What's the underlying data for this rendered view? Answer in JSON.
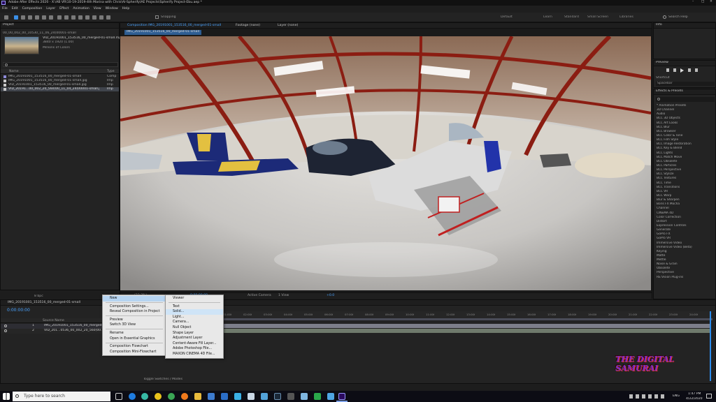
{
  "app": {
    "title": "Adobe After Effects 2020 - X:\\AB VR\\10-19-2019-4th Marina with Chris\\AI-Spherify\\AE Projects\\Spherify Project-Ebu.aep *"
  },
  "menubar": [
    "File",
    "Edit",
    "Composition",
    "Layer",
    "Effect",
    "Animation",
    "View",
    "Window",
    "Help"
  ],
  "toolbar": {
    "snapping_label": "Snapping",
    "workspaces": [
      "Default",
      "Learn",
      "Standard",
      "Small Screen",
      "Libraries"
    ],
    "search_placeholder": "Search Help"
  },
  "project_panel": {
    "tab": "Project",
    "top_label": "00_00_002_00_10530_11_06_24(00001-small",
    "preview_name": "VID_20191001_153516_00_merged-01-small.mp4 ▾",
    "preview_dims": "3840 x 1920 (1.00)",
    "preview_dur": "Millions of Colors",
    "search_icon": "search-icon",
    "col_name": "Name",
    "col_type": "Type",
    "items": [
      {
        "name": "IMG_20191001_153516_00_merged-01-small",
        "type": "Comp"
      },
      {
        "name": "IMG_20191001_153516_00_merged-01-small.jpg",
        "type": "Imp"
      },
      {
        "name": "VID_20191001_153516_00_merged-01-small.jpg",
        "type": "Imp"
      },
      {
        "name": "VID_20191...00_002_20_560(00_11_04_24(00001-small.jpg",
        "type": "Imp"
      }
    ],
    "bpc": "8 bpc"
  },
  "comp_panel": {
    "tabs": [
      "Composition IMG_20191001_153516_00_merged-01-small",
      "Footage (none)",
      "Layer (none)"
    ],
    "subtab": "IMG_20191001_153516_00_merged-01-small",
    "footer": {
      "zoom": "(33.3%)",
      "time": "0:00:00:00",
      "camera": "Active Camera",
      "views": "1 View",
      "offset": "+0.0"
    }
  },
  "right_panels": {
    "info": "Info",
    "preview": "Preview",
    "shortcut_label": "Shortcut",
    "shortcut_value": "Spacebar",
    "effects_title": "Effects & Presets",
    "effects": [
      "* Animation Presets",
      "3D Channel",
      "Audio",
      "BCC 3D Objects",
      "BCC Art Looks",
      "BCC Blur",
      "BCC Browser",
      "BCC Color & Tone",
      "BCC Film Style",
      "BCC Image Restoration",
      "BCC Key & Blend",
      "BCC Lights",
      "BCC Match Move",
      "BCC Obsolete",
      "BCC Particles",
      "BCC Perspective",
      "BCC Stylize",
      "BCC Textures",
      "BCC Time",
      "BCC Transitions",
      "BCC VR",
      "BCC Warp",
      "Blur & Sharpen",
      "Boris FX Mocha",
      "Channel",
      "CINEMA 4D",
      "Color Correction",
      "Distort",
      "Expression Controls",
      "Generate",
      "GoPro FX",
      "GoPro VR",
      "Immersive Video",
      "Immersive Video (Beta)",
      "Keying",
      "Matte",
      "Mettle",
      "Noise & Grain",
      "Obsolete",
      "Perspective",
      "RE:Vision Plug-ins"
    ]
  },
  "timeline": {
    "tab": "IMG_20191001_153516_00_merged-01-small",
    "timecode": "0:00:00:00",
    "col_source": "Source Name",
    "layers": [
      {
        "num": "1",
        "name": "IMG_20191001_153516_00_merged..."
      },
      {
        "num": "2",
        "name": "VID_201...0536_00_002_20_560(00..."
      }
    ],
    "ruler": [
      "01:00f",
      "02:00f",
      "03:00f",
      "04:00f",
      "05:00f",
      "06:00f",
      "07:00f",
      "08:00f",
      "09:00f",
      "10:00f",
      "11:00f",
      "12:00f",
      "13:00f",
      "14:00f",
      "15:00f",
      "16:00f",
      "17:00f",
      "18:00f",
      "19:00f",
      "20:00f",
      "21:00f",
      "22:00f",
      "23:00f",
      "24:00f"
    ],
    "footer": "Toggle Switches / Modes"
  },
  "context_menu": {
    "items": [
      "New",
      "Composition Settings...",
      "Reveal Composition in Project",
      "Preview",
      "Switch 3D View",
      "Rename",
      "Open in Essential Graphics",
      "Composition Flowchart",
      "Composition Mini-Flowchart"
    ]
  },
  "submenu": {
    "items": [
      "Viewer",
      "Text",
      "Solid...",
      "Light...",
      "Camera...",
      "Null Object",
      "Shape Layer",
      "Adjustment Layer",
      "Content-Aware Fill Layer...",
      "Adobe Photoshop File...",
      "MAXON CINEMA 4D File..."
    ]
  },
  "watermark": {
    "text": "THE DIGITAL SAMURAI"
  },
  "taskbar": {
    "search_placeholder": "Type here to search",
    "time": "1:47 PM",
    "date": "4/22/2020",
    "lang": "ENG"
  },
  "colors": {
    "accent": "#2d8ceb",
    "timecode": "#4aa3ff",
    "menu_highlight": "#b6d4f1"
  }
}
